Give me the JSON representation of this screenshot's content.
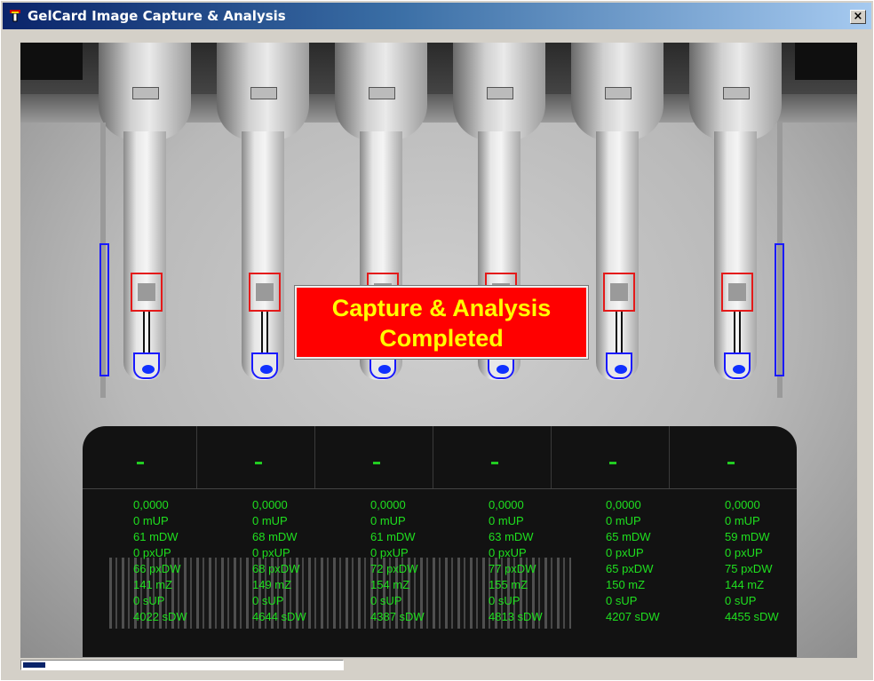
{
  "window": {
    "title": "GelCard Image Capture & Analysis",
    "close_label": "×"
  },
  "banner": {
    "line1": "Capture & Analysis",
    "line2": "Completed"
  },
  "columns": [
    {
      "status": "-",
      "lines": [
        "0,0000",
        "0 mUP",
        "61 mDW",
        "0 pxUP",
        "66 pxDW",
        "141 mZ",
        "0 sUP",
        "4022 sDW"
      ]
    },
    {
      "status": "-",
      "lines": [
        "0,0000",
        "0 mUP",
        "68 mDW",
        "0 pxUP",
        "68 pxDW",
        "149 mZ",
        "0 sUP",
        "4644 sDW"
      ]
    },
    {
      "status": "-",
      "lines": [
        "0,0000",
        "0 mUP",
        "61 mDW",
        "0 pxUP",
        "72 pxDW",
        "154 mZ",
        "0 sUP",
        "4387 sDW"
      ]
    },
    {
      "status": "-",
      "lines": [
        "0,0000",
        "0 mUP",
        "63 mDW",
        "0 pxUP",
        "77 pxDW",
        "155 mZ",
        "0 sUP",
        "4813 sDW"
      ]
    },
    {
      "status": "-",
      "lines": [
        "0,0000",
        "0 mUP",
        "65 mDW",
        "0 pxUP",
        "65 pxDW",
        "150 mZ",
        "0 sUP",
        "4207 sDW"
      ]
    },
    {
      "status": "-",
      "lines": [
        "0,0000",
        "0 mUP",
        "59 mDW",
        "0 pxUP",
        "75 pxDW",
        "144 mZ",
        "0 sUP",
        "4455 sDW"
      ]
    }
  ],
  "progress": {
    "value": 0.07
  },
  "colors": {
    "banner_bg": "#ff0000",
    "banner_text": "#ffff00",
    "readout_text": "#1fe01f",
    "marker_blue": "#1a1aff",
    "marker_red": "#e41a1a"
  },
  "icons": {
    "title": "gelcard-app-icon",
    "close": "close-icon"
  }
}
